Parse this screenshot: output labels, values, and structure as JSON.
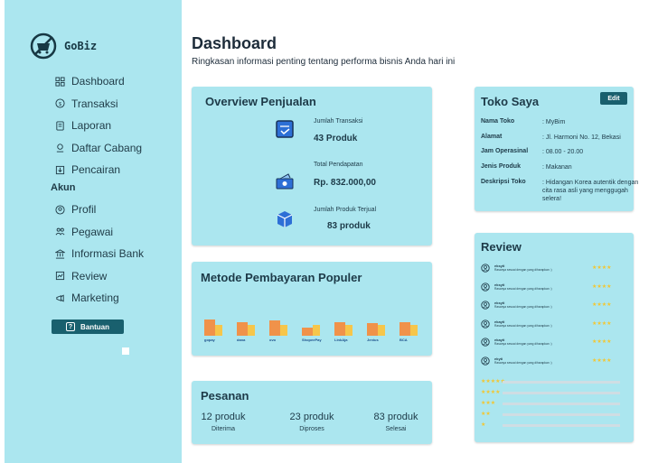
{
  "brand": {
    "name": "GoBiz"
  },
  "sidebar": {
    "items": [
      {
        "label": "Dashboard",
        "icon": "grid-icon"
      },
      {
        "label": "Transaksi",
        "icon": "coin-icon"
      },
      {
        "label": "Laporan",
        "icon": "document-icon"
      },
      {
        "label": "Daftar Cabang",
        "icon": "location-icon"
      },
      {
        "label": "Pencairan",
        "icon": "withdraw-icon"
      }
    ],
    "section_label": "Akun",
    "account_items": [
      {
        "label": "Profil",
        "icon": "user-icon"
      },
      {
        "label": "Pegawai",
        "icon": "team-icon"
      },
      {
        "label": "Informasi Bank",
        "icon": "bank-icon"
      },
      {
        "label": "Review",
        "icon": "review-icon"
      },
      {
        "label": "Marketing",
        "icon": "megaphone-icon"
      }
    ],
    "help_label": "Bantuan"
  },
  "header": {
    "title": "Dashboard",
    "subtitle": "Ringkasan informasi penting tentang performa bisnis Anda hari ini"
  },
  "overview": {
    "title": "Overview Penjualan",
    "items": [
      {
        "label": "Jumlah Transaksi",
        "value": "43 Produk",
        "icon": "transaction-icon"
      },
      {
        "label": "Total Pendapatan",
        "value": "Rp. 832.000,00",
        "icon": "money-icon"
      },
      {
        "label": "Jumlah Produk Terjual",
        "value": "83 produk",
        "icon": "box-icon"
      }
    ]
  },
  "payment": {
    "title": "Metode Pembayaran Populer",
    "methods": [
      {
        "name": "gopay",
        "orange": 0.6,
        "yellow": 0.35
      },
      {
        "name": "dana",
        "orange": 0.45,
        "yellow": 0.35
      },
      {
        "name": "ovo",
        "orange": 0.55,
        "yellow": 0.35
      },
      {
        "name": "ShopeePay",
        "orange": 0.2,
        "yellow": 0.35
      },
      {
        "name": "LinkAja",
        "orange": 0.45,
        "yellow": 0.35
      },
      {
        "name": "Jenius",
        "orange": 0.4,
        "yellow": 0.35
      },
      {
        "name": "BCA",
        "orange": 0.45,
        "yellow": 0.35
      }
    ],
    "colors": {
      "primary": "#f0924a",
      "secondary": "#f6c64a"
    }
  },
  "orders": {
    "title": "Pesanan",
    "stats": [
      {
        "value": "12 produk",
        "label": "Diterima"
      },
      {
        "value": "23 produk",
        "label": "Diproses"
      },
      {
        "value": "83 produk",
        "label": "Selesai"
      }
    ]
  },
  "store": {
    "title": "Toko Saya",
    "edit_label": "Edit",
    "fields": [
      {
        "key": "Nama Toko",
        "value": ": MyBim"
      },
      {
        "key": "Alamat",
        "value": ": Jl. Harmoni No. 12, Bekasi"
      },
      {
        "key": "Jam Operasinal",
        "value": ": 08.00 - 20.00"
      },
      {
        "key": "Jenis Produk",
        "value": ": Makanan"
      },
      {
        "key": "Deskripsi Toko",
        "value": ": Hidangan Korea autentik dengan cita rasa asli yang menggugah selera!"
      }
    ]
  },
  "review": {
    "title": "Review",
    "items": [
      {
        "name": "eksyti",
        "text": "Rasanya sesuai dengan yang diharapkan :)",
        "stars": "★★★★"
      },
      {
        "name": "eksyti",
        "text": "Rasanya sesuai dengan yang diharapkan :)",
        "stars": "★★★★"
      },
      {
        "name": "eksyti",
        "text": "Rasanya sesuai dengan yang diharapkan :)",
        "stars": "★★★★"
      },
      {
        "name": "ekayti",
        "text": "Rasanya sesuai dengan yang diharapkan :)",
        "stars": "★★★★"
      },
      {
        "name": "ekayti",
        "text": "Rasanya sesuai dengan yang diharapkan :)",
        "stars": "★★★★"
      },
      {
        "name": "ekyti",
        "text": "Rasanya sesuai dengan yang diharapkan :)",
        "stars": "★★★★"
      }
    ],
    "rating_rows": [
      "★★★★★",
      "★★★★",
      "★★★",
      "★★",
      "★"
    ],
    "star_color": "#f3c631"
  }
}
